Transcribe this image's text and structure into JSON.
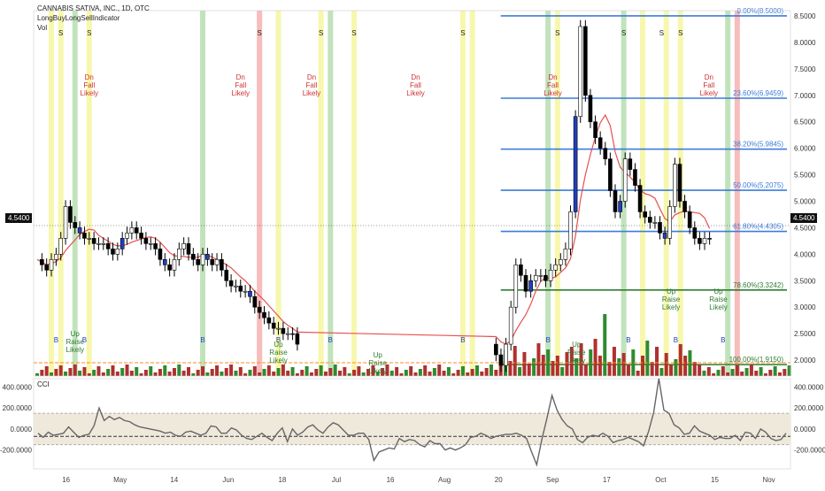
{
  "header": {
    "title": "CANNABIS SATIVA, INC., 1D, OTC",
    "indicator": "LongBuyLongSellIndicator",
    "volume_label": "Vol"
  },
  "current_price": "4.5400",
  "colors": {
    "up_candle": "#ffffff",
    "down_candle": "#000000",
    "blue_candle": "#1f3fbf",
    "ma_red": "#e5504f",
    "ma_green": "#4caf50",
    "fib_blue": "#3d7bd9",
    "fib_green": "#2e7d32",
    "stripe_yellow": "#f4f48a",
    "stripe_green": "#a7d7a0",
    "stripe_red": "#f4a0a0",
    "vol_green": "#2e8b2e",
    "vol_red": "#b03030",
    "cci_line": "#666666",
    "cci_band": "#efe9dc"
  },
  "chart_data": [
    {
      "type": "candlestick",
      "yaxis_ticks": [
        "8.5000",
        "8.0000",
        "7.5000",
        "7.0000",
        "6.5000",
        "6.0000",
        "5.5000",
        "5.0000",
        "4.5000",
        "4.0000",
        "3.5000",
        "3.0000",
        "2.5000",
        "2.0000"
      ],
      "ylim": [
        1.7,
        8.6
      ],
      "x_ticks": [
        "16",
        "May",
        "14",
        "Jun",
        "18",
        "Jul",
        "16",
        "Aug",
        "20",
        "Sep",
        "17",
        "Oct",
        "15",
        "Nov"
      ],
      "fib_levels": [
        {
          "label": "0.00%(8.5000)",
          "value": 8.5
        },
        {
          "label": "23.60%(6.9459)",
          "value": 6.9459
        },
        {
          "label": "38.20%(5.9845)",
          "value": 5.9845
        },
        {
          "label": "50.00%(5.2075)",
          "value": 5.2075
        },
        {
          "label": "61.80%(4.4305)",
          "value": 4.4305
        },
        {
          "label": "78.60%(3.3242)",
          "value": 3.3242
        },
        {
          "label": "100.00%(1.9150)",
          "value": 1.915
        }
      ],
      "signals": [
        {
          "text": "Dn\nFall\nLikely",
          "day": 11,
          "price": 7.3,
          "color": "#d03030"
        },
        {
          "text": "Dn\nFall\nLikely",
          "day": 43,
          "price": 7.3,
          "color": "#d03030"
        },
        {
          "text": "Dn\nFall\nLikely",
          "day": 58,
          "price": 7.3,
          "color": "#d03030"
        },
        {
          "text": "Dn\nFall\nLikely",
          "day": 80,
          "price": 7.3,
          "color": "#d03030"
        },
        {
          "text": "Dn\nFall\nLikely",
          "day": 109,
          "price": 7.3,
          "color": "#d03030"
        },
        {
          "text": "Dn\nFall\nLikely",
          "day": 142,
          "price": 7.3,
          "color": "#d03030"
        },
        {
          "text": "Up\nRaise\nLikely",
          "day": 8,
          "price": 2.45,
          "color": "#2e7d32"
        },
        {
          "text": "Up\nRaise\nLikely",
          "day": 51,
          "price": 2.25,
          "color": "#2e7d32"
        },
        {
          "text": "Up\nRaise\nLikely",
          "day": 72,
          "price": 2.05,
          "color": "#2e7d32"
        },
        {
          "text": "Up\nRaise\nLikely",
          "day": 114,
          "price": 2.25,
          "color": "#2e7d32"
        },
        {
          "text": "Up\nRaise\nLikely",
          "day": 134,
          "price": 3.25,
          "color": "#2e7d32"
        },
        {
          "text": "Up\nRaise\nLikely",
          "day": 144,
          "price": 3.25,
          "color": "#2e7d32"
        }
      ],
      "marks": [
        {
          "t": "S",
          "d": 5
        },
        {
          "t": "S",
          "d": 11
        },
        {
          "t": "S",
          "d": 47
        },
        {
          "t": "S",
          "d": 60
        },
        {
          "t": "S",
          "d": 67
        },
        {
          "t": "S",
          "d": 90
        },
        {
          "t": "S",
          "d": 110
        },
        {
          "t": "S",
          "d": 124
        },
        {
          "t": "S",
          "d": 132
        },
        {
          "t": "S",
          "d": 136
        },
        {
          "t": "B",
          "d": 4
        },
        {
          "t": "B",
          "d": 10
        },
        {
          "t": "B",
          "d": 35
        },
        {
          "t": "B",
          "d": 51
        },
        {
          "t": "B",
          "d": 62
        },
        {
          "t": "B",
          "d": 90
        },
        {
          "t": "B",
          "d": 108
        },
        {
          "t": "B",
          "d": 125
        },
        {
          "t": "B",
          "d": 135
        },
        {
          "t": "B",
          "d": 145
        }
      ]
    },
    {
      "type": "line",
      "name": "CCI",
      "label": "CCI",
      "yaxis_ticks": [
        "400.0000",
        "200.0000",
        "0.0000",
        "-200.0000"
      ],
      "ylim": [
        -380,
        480
      ],
      "values": [
        -40,
        -80,
        -30,
        -60,
        -50,
        -40,
        20,
        -30,
        -80,
        -60,
        -50,
        30,
        200,
        80,
        120,
        90,
        110,
        80,
        70,
        40,
        20,
        10,
        0,
        -10,
        -20,
        -40,
        -30,
        -60,
        -70,
        -30,
        -20,
        -40,
        -60,
        -40,
        30,
        20,
        -40,
        -40,
        10,
        -10,
        -60,
        -90,
        -100,
        -70,
        -40,
        -80,
        -110,
        -40,
        10,
        -120,
        0,
        -60,
        -30,
        20,
        40,
        -10,
        -40,
        20,
        60,
        40,
        -10,
        -60,
        -60,
        -40,
        -40,
        -100,
        -300,
        -220,
        -200,
        -180,
        -190,
        -90,
        -120,
        -100,
        -110,
        -150,
        -170,
        -110,
        -140,
        -140,
        -200,
        -180,
        -200,
        -180,
        -150,
        -80,
        -70,
        -40,
        -60,
        -90,
        -70,
        -60,
        -50,
        -50,
        -40,
        -60,
        -90,
        -220,
        -340,
        -100,
        100,
        320,
        180,
        90,
        30,
        0,
        -100,
        -130,
        -80,
        -60,
        -70,
        -40,
        -70,
        -130,
        -110,
        -100,
        -80,
        -100,
        -120,
        -160,
        -20,
        160,
        480,
        180,
        150,
        40,
        10,
        -50,
        -40,
        30,
        -20,
        -40,
        -60,
        -100,
        -80,
        -90,
        -90,
        -60,
        -110,
        -30,
        -40,
        -90,
        0,
        -30,
        -90,
        -110,
        -100,
        -40
      ]
    }
  ]
}
